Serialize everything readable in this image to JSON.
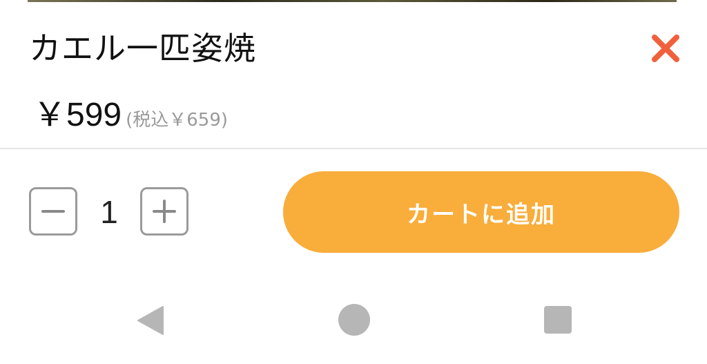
{
  "product": {
    "title": "カエル一匹姿焼",
    "price": "￥599",
    "price_tax": "(税込￥659)"
  },
  "cart": {
    "quantity": "1",
    "add_button_label": "カートに追加"
  },
  "icons": {
    "close": "close-icon",
    "minus": "minus-icon",
    "plus": "plus-icon",
    "back": "nav-back-icon",
    "home": "nav-home-icon",
    "recents": "nav-recents-icon"
  },
  "colors": {
    "accent": "#f9ad3b",
    "close": "#f0603d",
    "stepper_border": "#9a9a9a",
    "nav": "#b6b6b6"
  }
}
